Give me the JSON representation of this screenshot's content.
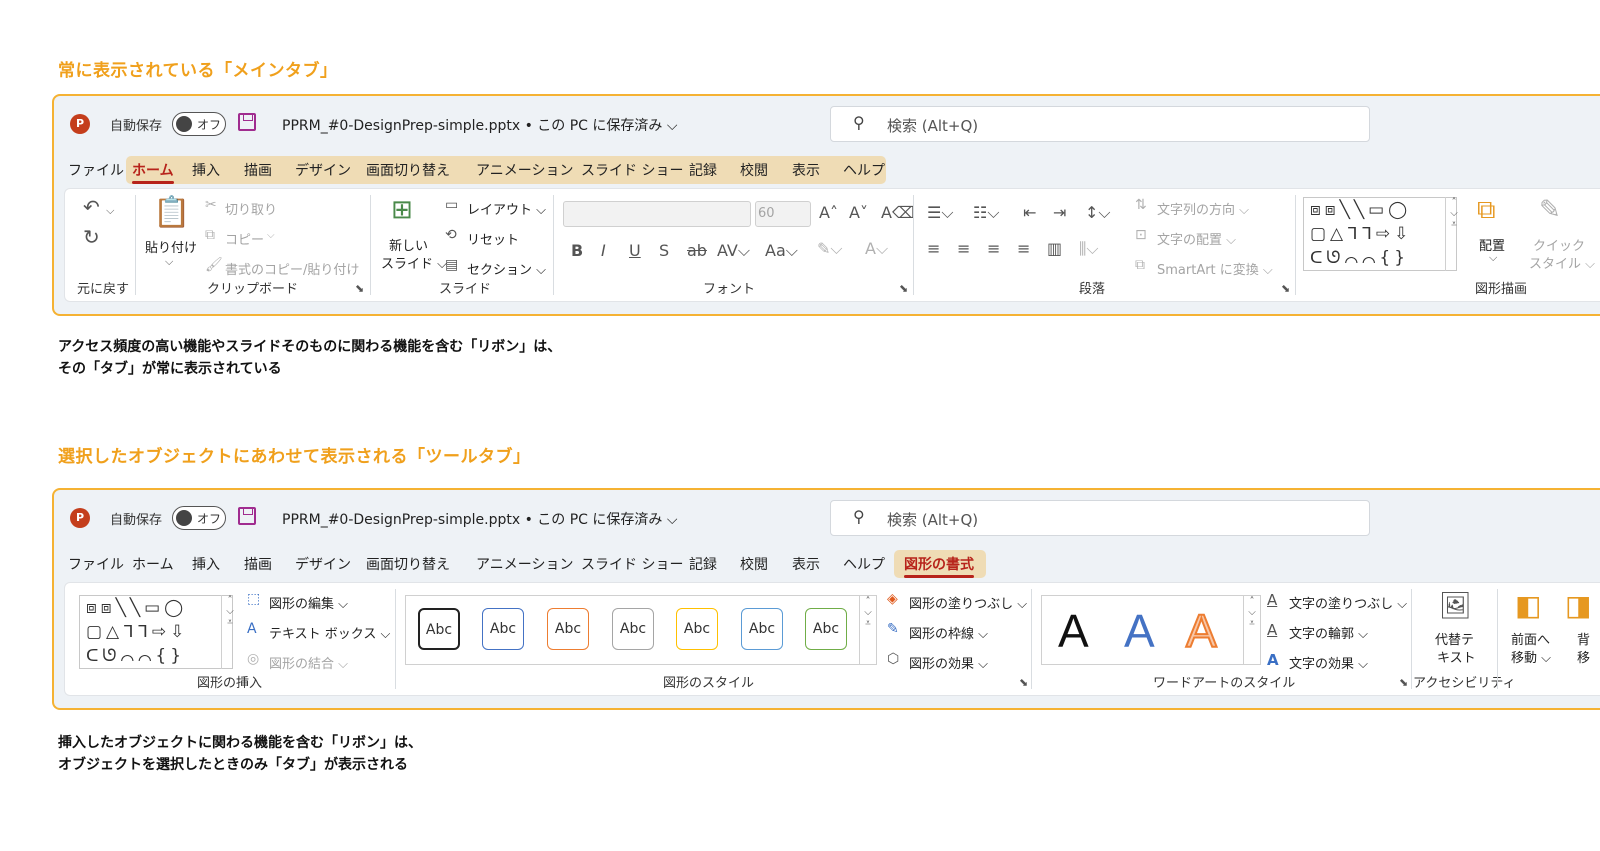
{
  "section1": {
    "heading": "常に表示されている「メインタブ」",
    "caption_line1": "アクセス頻度の高い機能やスライドそのものに関わる機能を含む「リボン」は、",
    "caption_line2": "その「タブ」が常に表示されている"
  },
  "section2": {
    "heading": "選択したオブジェクトにあわせて表示される「ツールタブ」",
    "caption_line1": "挿入したオブジェクトに関わる機能を含む「リボン」は、",
    "caption_line2": "オブジェクトを選択したときのみ「タブ」が表示される"
  },
  "titlebar": {
    "autosave_label": "自動保存",
    "toggle_label": "オフ",
    "filename": "PPRM_#0-DesignPrep-simple.pptx • この PC に保存済み ⌵",
    "search_placeholder": "検索 (Alt+Q)"
  },
  "tabs": [
    "ファイル",
    "ホーム",
    "挿入",
    "描画",
    "デザイン",
    "画面切り替え",
    "アニメーション",
    "スライド ショー",
    "記録",
    "校閲",
    "表示",
    "ヘルプ"
  ],
  "tool_tab": "図形の書式",
  "ribbon1": {
    "undo_label": "元に戻す",
    "paste": "貼り付け",
    "cut": "切り取り",
    "copy": "コピー",
    "format_painter": "書式のコピー/貼り付け",
    "clipboard": "クリップボード",
    "new_slide_1": "新しい",
    "new_slide_2": "スライド ⌵",
    "layout": "レイアウト ⌵",
    "reset": "リセット",
    "section": "セクション ⌵",
    "slides": "スライド",
    "font_size": "60",
    "font": "フォント",
    "text_direction": "文字列の方向 ⌵",
    "align_text": "文字の配置 ⌵",
    "smartart": "SmartArt に変換 ⌵",
    "paragraph": "段落",
    "arrange": "配置",
    "quick_styles_1": "クイック",
    "quick_styles_2": "スタイル ⌵",
    "drawing": "図形描画"
  },
  "ribbon2": {
    "edit_shape": "図形の編集 ⌵",
    "text_box": "テキスト ボックス ⌵",
    "merge_shapes": "図形の結合 ⌵",
    "insert_shapes": "図形の挿入",
    "abc": "Abc",
    "shape_fill": "図形の塗りつぶし ⌵",
    "shape_outline": "図形の枠線 ⌵",
    "shape_effects": "図形の効果 ⌵",
    "shape_styles": "図形のスタイル",
    "wordart_letter": "A",
    "text_fill": "文字の塗りつぶし ⌵",
    "text_outline": "文字の輪郭 ⌵",
    "text_effects": "文字の効果 ⌵",
    "wordart_styles": "ワードアートのスタイル",
    "alt_text_1": "代替テ",
    "alt_text_2": "キスト",
    "accessibility": "アクセシビリティ",
    "bring_forward_1": "前面へ",
    "bring_forward_2": "移動 ⌵",
    "send_back_1": "背",
    "send_back_2": "移"
  },
  "style_colors": [
    "#222222",
    "#4472c4",
    "#ed7d31",
    "#a5a5a5",
    "#ffc000",
    "#5b9bd5",
    "#70ad47"
  ],
  "colors": {
    "accent": "#f0a01c",
    "active_tab": "#b7231b",
    "tab_highlight": "#efdcb5"
  }
}
